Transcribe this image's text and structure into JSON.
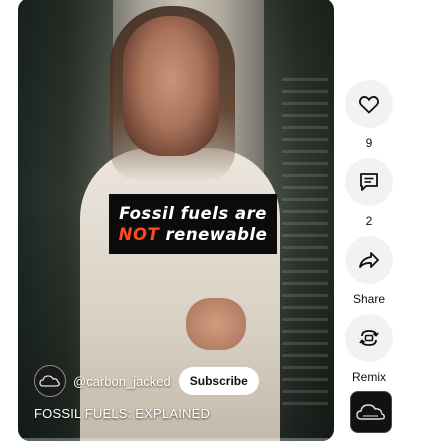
{
  "video": {
    "overlay_title_line1": "Fossil fuels are",
    "overlay_title_line2_prefix": "NOT",
    "overlay_title_line2_rest": " renewable",
    "channel_name": "@carbon_jacked",
    "subscribe_label": "Subscribe",
    "caption": "FOSSIL FUELS: EXPLAINED",
    "accent_color": "#ff4a1c"
  },
  "actions": {
    "like": {
      "icon": "heart-icon",
      "count": "9"
    },
    "comment": {
      "icon": "comment-icon",
      "count": "2"
    },
    "share": {
      "icon": "share-icon",
      "label": "Share"
    },
    "remix": {
      "icon": "remix-icon",
      "label": "Remix"
    },
    "sound": {
      "icon": "channel-thumbnail"
    }
  }
}
